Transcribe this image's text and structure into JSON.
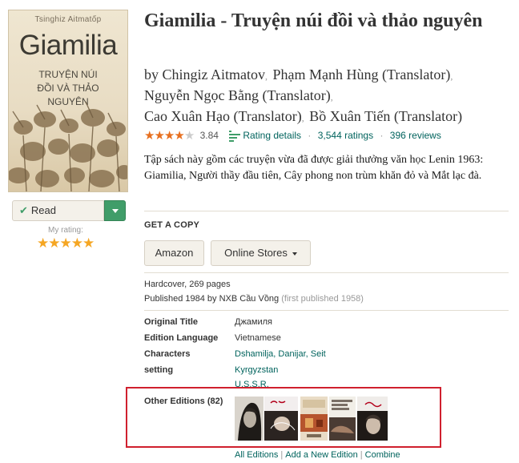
{
  "cover": {
    "author": "Tsinghiz Aitmatốp",
    "title": "Giamilia",
    "subtitle_lines": [
      "TRUYỆN NÚI",
      "ĐỒI VÀ THẢO",
      "NGUYÊN"
    ]
  },
  "shelf": {
    "read_label": "Read",
    "my_rating_label": "My rating:",
    "my_rating_stars": 5
  },
  "book": {
    "title": "Giamilia - Truyện núi đồi và thảo nguyên",
    "by_label": "by",
    "authors": [
      "Chingiz Aitmatov",
      "Phạm Mạnh Hùng (Translator)",
      "Nguyễn Ngọc Bằng (Translator)",
      "Cao Xuân Hạo (Translator)",
      "Bồ Xuân Tiến (Translator)"
    ],
    "rating": {
      "average": "3.84",
      "average_value": 3.84,
      "details_label": "Rating details",
      "ratings_count": "3,544 ratings",
      "reviews_count": "396 reviews"
    },
    "description": "Tập sách này gồm các truyện vừa đã được giải thưởng văn học Lenin 1963: Giamilia, Người thầy đầu tiên, Cây phong non trùm khăn đỏ và Mắt lạc đà."
  },
  "get_copy": {
    "heading": "GET A COPY",
    "amazon_label": "Amazon",
    "online_stores_label": "Online Stores"
  },
  "publication": {
    "format": "Hardcover, 269 pages",
    "published": "Published 1984 by NXB Cầu Vồng",
    "first_published": "(first published 1958)"
  },
  "details": {
    "original_title_label": "Original Title",
    "original_title": "Джамиля",
    "edition_language_label": "Edition Language",
    "edition_language": "Vietnamese",
    "characters_label": "Characters",
    "characters": "Dshamilja, Danijar, Seit",
    "setting_label": "setting",
    "setting_1": "Kyrgyzstan",
    "setting_2": "U.S.S.R."
  },
  "other_editions": {
    "label": "Other Editions (82)",
    "covers": [
      "edition-cover-1",
      "edition-cover-2",
      "edition-cover-3",
      "edition-cover-4",
      "edition-cover-5"
    ],
    "all_editions": "All Editions",
    "add_new_edition": "Add a New Edition",
    "combine": "Combine"
  },
  "colors": {
    "link": "#00635d",
    "read_green": "#409d69",
    "rating_star": "#e76f1f",
    "my_rating_star": "#f5a623",
    "highlight_box": "#d0202e"
  }
}
